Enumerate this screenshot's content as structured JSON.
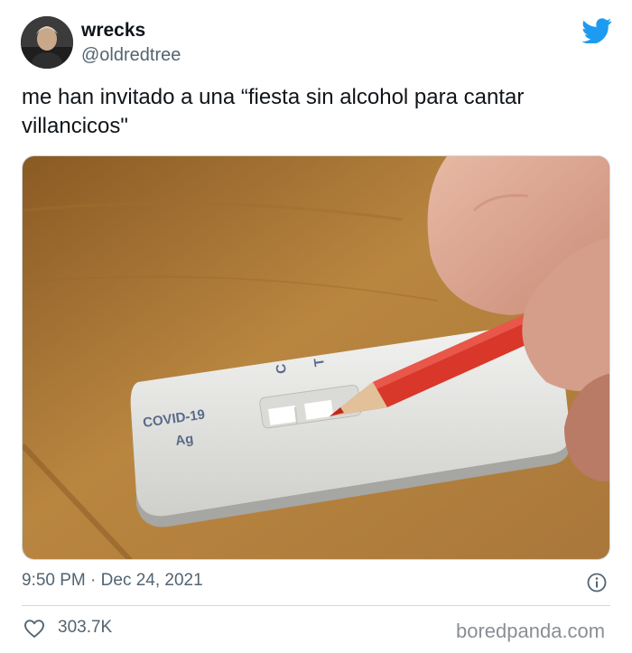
{
  "user": {
    "display_name": "wrecks",
    "handle": "@oldredtree"
  },
  "tweet": {
    "text": "me han invitado a una “fiesta sin alcohol para cantar\nvillancicos\"",
    "time": "9:50 PM",
    "separator": "·",
    "date": "Dec 24, 2021",
    "likes": "303.7K"
  },
  "media": {
    "test_label_line1": "COVID-19",
    "test_label_line2": "Ag",
    "marker_c": "C",
    "marker_t": "T"
  },
  "watermark": "boredpanda.com",
  "icons": {
    "brand": "twitter-bird-icon",
    "info": "info-icon",
    "like": "heart-icon"
  },
  "colors": {
    "twitter_blue": "#1d9bf0",
    "secondary_text": "#536471",
    "divider": "#cfd9de",
    "pencil_red": "#d8372a"
  }
}
